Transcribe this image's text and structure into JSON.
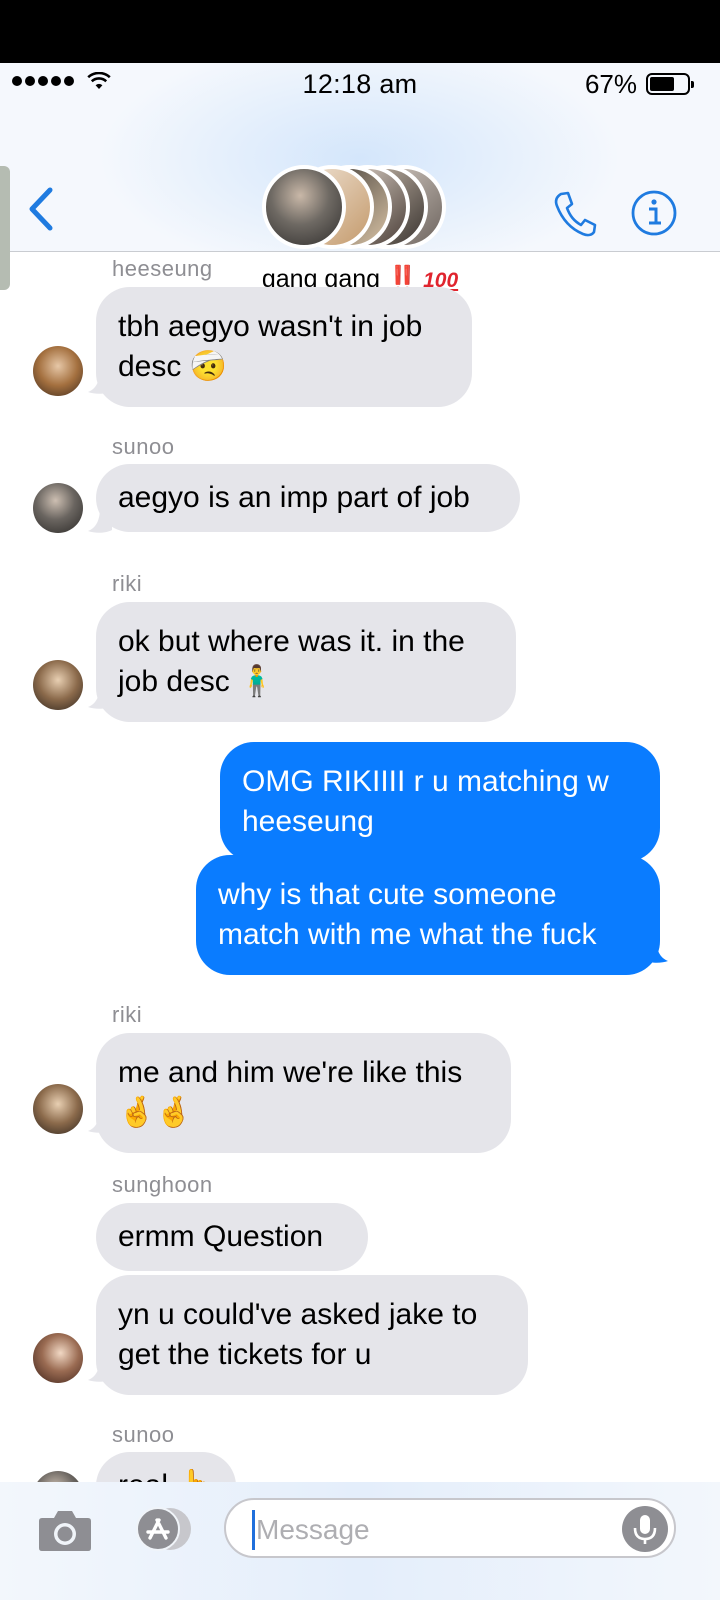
{
  "status_bar": {
    "time": "12:18 am",
    "battery": "67%"
  },
  "header": {
    "group_name": "gang gang",
    "group_emoji_marks": "‼️",
    "group_emoji_hundred": "100",
    "members_shown": 6
  },
  "messages": [
    {
      "sender": "heeseung",
      "lines": [
        "tbh aegyo wasn't in job",
        "desc 🤕"
      ],
      "direction": "in"
    },
    {
      "sender": "sunoo",
      "lines": [
        "aegyo is an imp part of job"
      ],
      "direction": "in"
    },
    {
      "sender": "riki",
      "lines": [
        "ok but where was it. in the",
        "job desc 🧍‍♂️"
      ],
      "direction": "in"
    },
    {
      "sender": "",
      "lines": [
        "OMG RIKIIII r u matching w",
        "heeseung"
      ],
      "direction": "out"
    },
    {
      "sender": "",
      "lines": [
        "why is that cute someone",
        "match with me what the fuck"
      ],
      "direction": "out"
    },
    {
      "sender": "riki",
      "lines": [
        "me and him we're like this",
        "🤞🤞"
      ],
      "direction": "in"
    },
    {
      "sender": "sunghoon",
      "lines": [
        "ermm Question"
      ],
      "direction": "in"
    },
    {
      "sender": "",
      "lines": [
        "yn u could've asked jake to",
        "get the tickets for u"
      ],
      "direction": "in"
    },
    {
      "sender": "sunoo",
      "lines": [
        "real 👆"
      ],
      "direction": "in"
    }
  ],
  "input": {
    "placeholder": "Message"
  },
  "colors": {
    "outgoing": "#0a7cff",
    "incoming": "#e5e5ea",
    "accent": "#1f7be0"
  },
  "icons": [
    "back-chevron-icon",
    "phone-icon",
    "info-icon",
    "camera-icon",
    "app-store-icon",
    "microphone-icon"
  ]
}
